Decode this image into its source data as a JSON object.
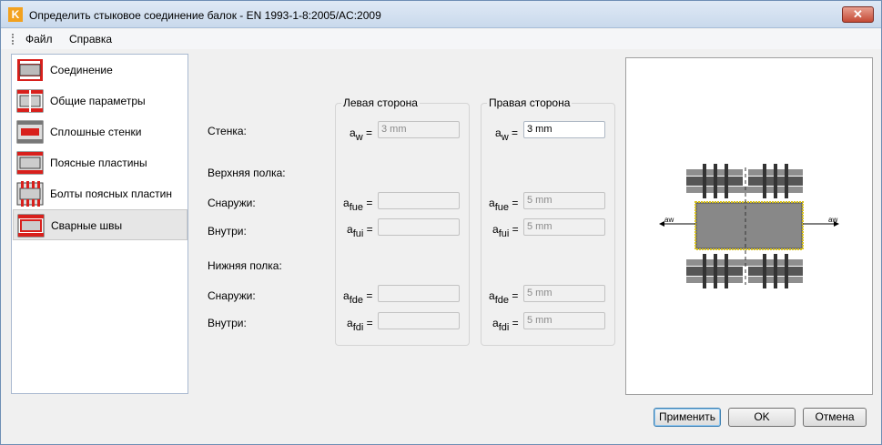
{
  "window": {
    "title": "Определить стыковое соединение балок - EN 1993-1-8:2005/AC:2009",
    "close_glyph": "✕"
  },
  "menu": {
    "file": "Файл",
    "help": "Справка"
  },
  "nav": {
    "items": [
      {
        "label": "Соединение",
        "icon": "joint-icon"
      },
      {
        "label": "Общие параметры",
        "icon": "general-params-icon"
      },
      {
        "label": "Сплошные стенки",
        "icon": "web-plates-icon"
      },
      {
        "label": "Поясные пластины",
        "icon": "flange-plates-icon"
      },
      {
        "label": "Болты поясных пластин",
        "icon": "flange-bolts-icon"
      },
      {
        "label": "Сварные швы",
        "icon": "welds-icon",
        "selected": true
      }
    ]
  },
  "form": {
    "row_web": "Стенка:",
    "row_top_flange": "Верхняя полка:",
    "row_outside": "Снаружи:",
    "row_inside": "Внутри:",
    "row_bottom_flange": "Нижняя полка:",
    "left_group": "Левая сторона",
    "right_group": "Правая сторона",
    "symbols": {
      "aw": {
        "base": "a",
        "sub": "w"
      },
      "afue": {
        "base": "a",
        "sub": "fue"
      },
      "afui": {
        "base": "a",
        "sub": "fui"
      },
      "afde": {
        "base": "a",
        "sub": "fde"
      },
      "afdi": {
        "base": "a",
        "sub": "fdi"
      },
      "eq": "="
    },
    "left": {
      "aw": "3 mm",
      "afue": "",
      "afui": "",
      "afde": "",
      "afdi": ""
    },
    "right": {
      "aw": "3 mm",
      "afue": "5 mm",
      "afui": "5 mm",
      "afde": "5 mm",
      "afdi": "5 mm"
    }
  },
  "preview": {
    "weld_label_left": "aw",
    "weld_label_right": "aw"
  },
  "buttons": {
    "apply": "Применить",
    "ok": "OK",
    "cancel": "Отмена"
  },
  "colors": {
    "accent_red": "#d8201c",
    "weld_yellow": "#d9c21a",
    "steel_gray": "#8e8e8e"
  }
}
